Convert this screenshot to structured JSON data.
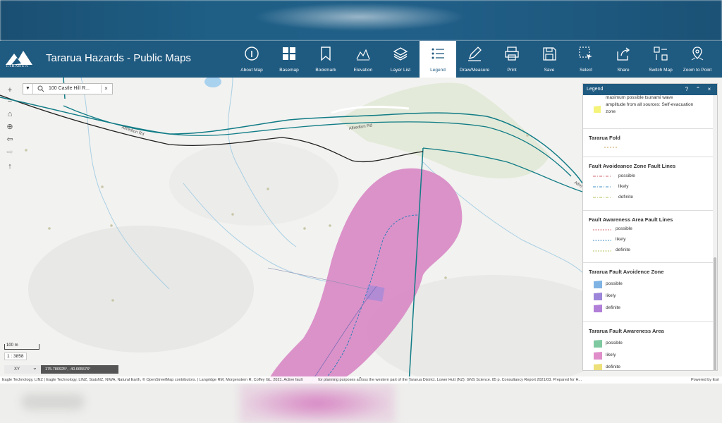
{
  "app": {
    "title": "Tararua Hazards - Public Maps",
    "logo_text": "TARARUA"
  },
  "toolbar": [
    {
      "id": "about",
      "label": "About Map",
      "icon": "info-icon"
    },
    {
      "id": "basemap",
      "label": "Basemap",
      "icon": "grid-icon"
    },
    {
      "id": "bookmark",
      "label": "Bookmark",
      "icon": "bookmark-icon"
    },
    {
      "id": "elevation",
      "label": "Elevation",
      "icon": "elevation-icon"
    },
    {
      "id": "layerlist",
      "label": "Layer List",
      "icon": "layers-icon"
    },
    {
      "id": "legend",
      "label": "Legend",
      "icon": "legend-icon",
      "active": true
    },
    {
      "id": "draw",
      "label": "Draw/Measure",
      "icon": "pencil-icon"
    },
    {
      "id": "print",
      "label": "Print",
      "icon": "printer-icon"
    },
    {
      "id": "save",
      "label": "Save",
      "icon": "floppy-icon"
    },
    {
      "id": "select",
      "label": "Select",
      "icon": "select-icon"
    },
    {
      "id": "share",
      "label": "Share",
      "icon": "share-icon"
    },
    {
      "id": "switchmap",
      "label": "Switch Map",
      "icon": "switch-map-icon"
    },
    {
      "id": "zoomto",
      "label": "Zoom to Point",
      "icon": "pin-icon"
    }
  ],
  "map": {
    "search_value": "100 Castle Hill R...",
    "road_labels": [
      "Alfredton Rd",
      "Alfredton Rd",
      "Alfre"
    ],
    "scale_text": "100 m",
    "scale_ratio": "1 : 3858",
    "coord_system": "XY",
    "coord_value": "175.780925°, -40.665576°",
    "attribution": "Eagle Technology, LINZ | Eagle Technology, LINZ, StatsNZ, NIWA, Natural Earth, © OpenStreetMap contributors. | Langridge RM, Morgenstern R, Coffey GL. 2021. Active fault",
    "attribution_tail": "for planning purposes across the western part of the Tararua District. Lower Hutt (NZ): GNS Science. 85 p. Consultancy Report 2021/03. Prepared for H...",
    "powered_by": "Powered by Esri"
  },
  "legend": {
    "title": "Legend",
    "partial_text_1": "maximum possible tsunami wave",
    "partial_text_2": "amplitude from all sources: Self-evacuation",
    "partial_text_3": "zone",
    "sections": [
      {
        "title": "Tararua Fold",
        "items": []
      },
      {
        "title": "Fault Avoideance Zone Fault Lines",
        "items": [
          "possible",
          "likely",
          "definite"
        ]
      },
      {
        "title": "Fault Awareness Area Fault Lines",
        "items": [
          "possible",
          "likely",
          "definite"
        ]
      },
      {
        "title": "Tararua Fault Avoidence Zone",
        "items": [
          "possible",
          "likely",
          "definite"
        ]
      },
      {
        "title": "Tararua Fault Awareness Area",
        "items": [
          "possible",
          "likely",
          "definite"
        ]
      }
    ]
  },
  "colors": {
    "header": "#1f5a80",
    "fault_zone_pink": "#d98cc6",
    "road_teal": "#117c86"
  }
}
